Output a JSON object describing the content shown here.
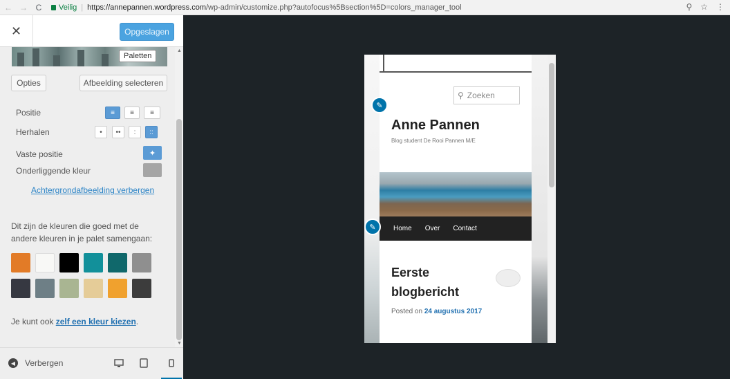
{
  "browser": {
    "secure_label": "Veilig",
    "url_host": "https://annepannen.wordpress.com",
    "url_path": "/wp-admin/customize.php?autofocus%5Bsection%5D=colors_manager_tool"
  },
  "header": {
    "close_label": "✕",
    "save_label": "Opgeslagen"
  },
  "background_image": {
    "tooltip": "Paletten",
    "options_label": "Opties",
    "select_label": "Afbeelding selecteren",
    "position_label": "Positie",
    "repeat_label": "Herhalen",
    "fixed_label": "Vaste positie",
    "underlying_color_label": "Onderliggende kleur",
    "underlying_color": "#a5a5a5",
    "hide_link": "Achtergrondafbeelding verbergen"
  },
  "palette": {
    "description": "Dit zijn de kleuren die goed met de andere kleuren in je palet samengaan:",
    "colors": [
      "#e27b27",
      "#f8f8f6",
      "#000000",
      "#12909a",
      "#10686b",
      "#8f8f8f",
      "#363841",
      "#6e7f86",
      "#a9b592",
      "#e5cc98",
      "#f0a12e",
      "#3c3c3c"
    ],
    "custom_prefix": "Je kunt ook ",
    "custom_link": "zelf een kleur kiezen",
    "custom_suffix": "."
  },
  "footer": {
    "hide_label": "Verbergen"
  },
  "preview": {
    "search_placeholder": "Zoeken",
    "site_title": "Anne Pannen",
    "site_description": "Blog student De Rooi Pannen M/E",
    "nav_items": [
      "Home",
      "Over",
      "Contact"
    ],
    "post_title": "Eerste blogbericht",
    "posted_on": "Posted on ",
    "post_date": "24 augustus 2017"
  }
}
